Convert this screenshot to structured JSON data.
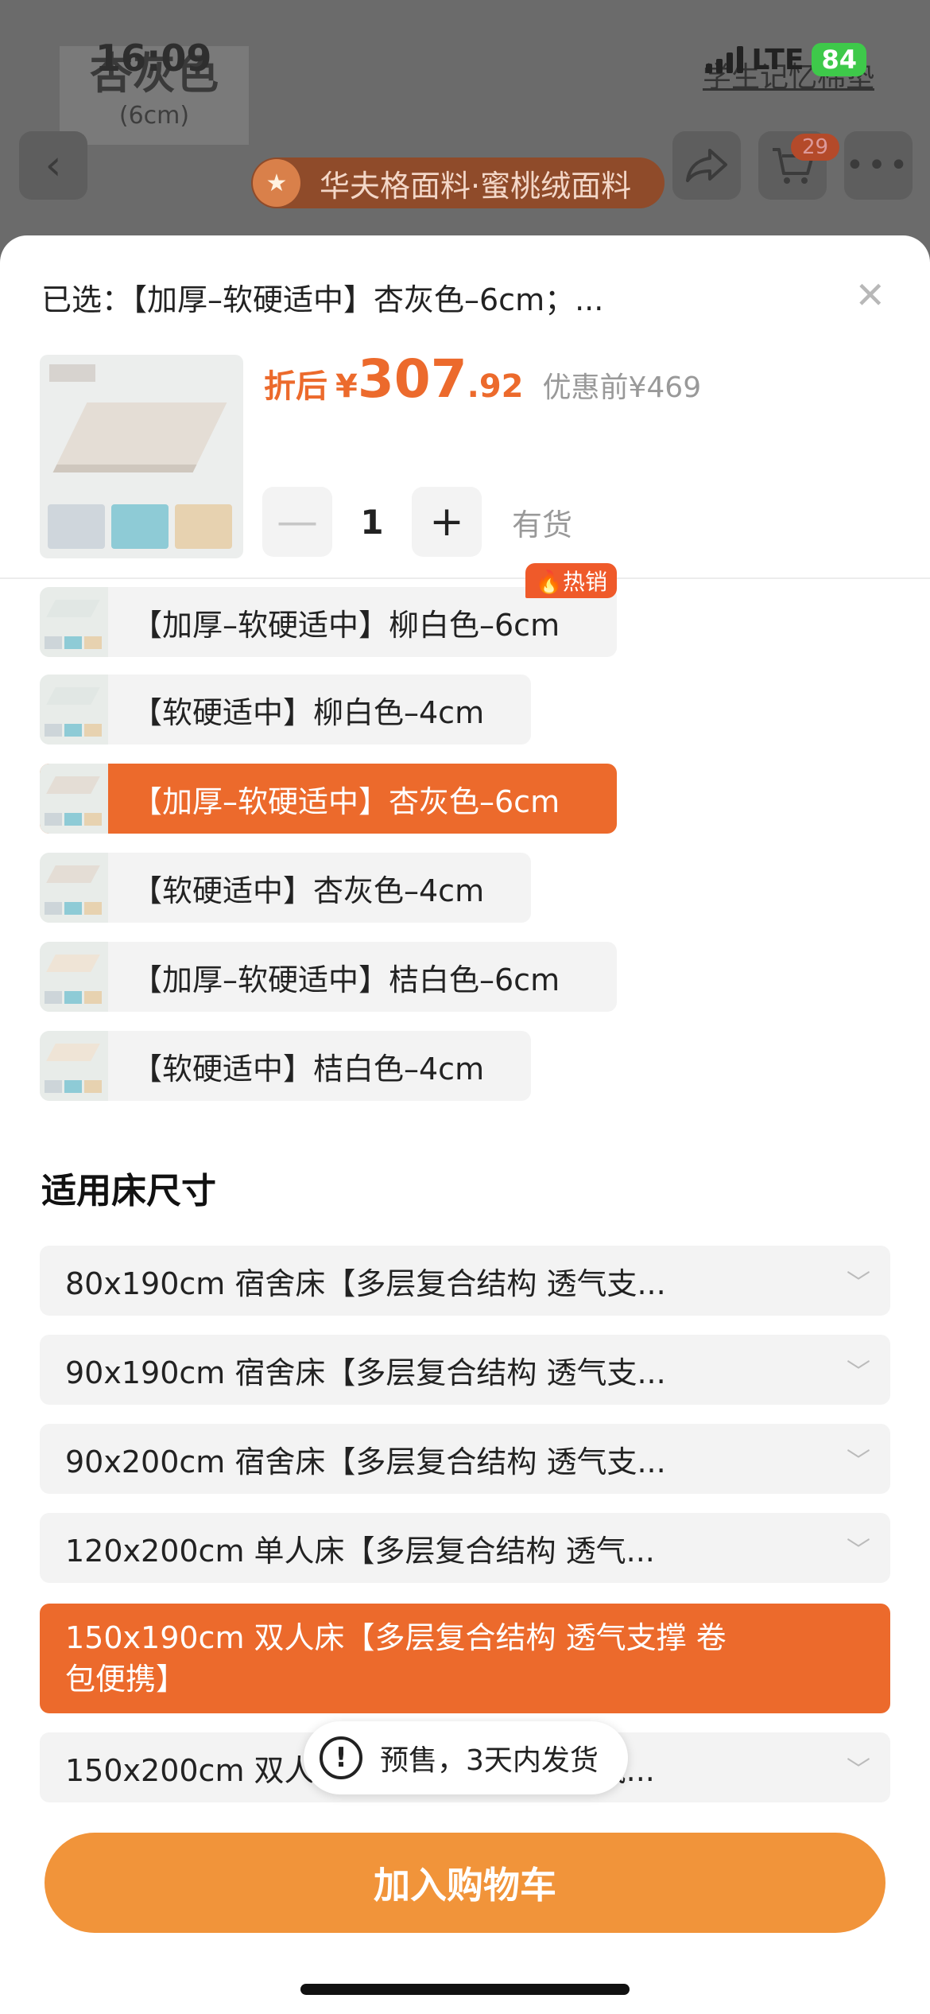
{
  "status": {
    "time": "16:09",
    "network": "LTE",
    "battery": "84"
  },
  "background": {
    "variant_label": "杏灰色",
    "variant_sub": "(6cm)",
    "brand": "学生记忆棉垫",
    "cart_count": "29",
    "promo": "华夫格面料·蜜桃绒面料"
  },
  "sheet": {
    "selected_text": "已选：【加厚–软硬适中】杏灰色–6cm；...",
    "price_prefix": "折后",
    "price_yen": "¥",
    "price_int": "307",
    "price_dec": ".92",
    "price_original": "优惠前¥469",
    "quantity": "1",
    "stock": "有货",
    "options": [
      {
        "label": "【加厚–软硬适中】柳白色–6cm",
        "badge": "热销"
      },
      {
        "label": "【软硬适中】柳白色–4cm"
      },
      {
        "label": "【加厚–软硬适中】杏灰色–6cm"
      },
      {
        "label": "【软硬适中】杏灰色–4cm"
      },
      {
        "label": "【加厚–软硬适中】桔白色–6cm"
      },
      {
        "label": "【软硬适中】桔白色–4cm"
      }
    ],
    "size_section_title": "适用床尺寸",
    "sizes": [
      {
        "label": "80x190cm 宿舍床【多层复合结构 透气支..."
      },
      {
        "label": "90x190cm 宿舍床【多层复合结构 透气支..."
      },
      {
        "label": "90x200cm 宿舍床【多层复合结构 透气支..."
      },
      {
        "label": "120x200cm 单人床【多层复合结构 透气..."
      },
      {
        "label": "150x190cm 双人床【多层复合结构 透气支撑 卷包便携】"
      },
      {
        "label": "150x200cm 双人床【多层复合结构 透气..."
      }
    ],
    "toast": "预售，3天内发货",
    "add_to_cart": "加入购物车"
  },
  "icons": {
    "back": "chevron-left-icon",
    "share": "share-icon",
    "cart": "cart-icon",
    "more": "more-icon",
    "close": "close-icon",
    "hot": "flame-icon",
    "chevron": "chevron-down-icon",
    "alert": "exclamation-icon"
  },
  "colors": {
    "accent": "#ec6a2c",
    "cta": "#f1943a",
    "hot": "#ef5a2a"
  }
}
